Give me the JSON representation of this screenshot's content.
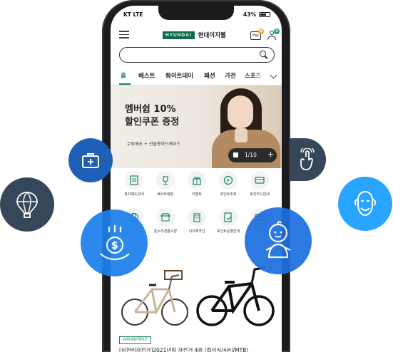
{
  "status_bar": {
    "carrier": "KT  LTE",
    "battery": "43%"
  },
  "header": {
    "logo_mark": "HYUNDAI",
    "logo_text": "현대이지웰",
    "npay_label": "Pay",
    "npay_badge": "N",
    "user_badge": "2"
  },
  "search": {
    "placeholder": ""
  },
  "tabs": [
    {
      "label": "홈",
      "active": true
    },
    {
      "label": "베스트"
    },
    {
      "label": "화이트데이"
    },
    {
      "label": "패션"
    },
    {
      "label": "가전"
    },
    {
      "label": "스포츠"
    }
  ],
  "banner": {
    "title_line1": "멤버쉽 10%",
    "title_line2": "할인쿠폰 증정",
    "subtitle": "무료배송 + 선물용하드케이스",
    "page_indicator": "1/10",
    "plus": "+"
  },
  "quick_menu": [
    {
      "label": "복지제도안내",
      "icon": "document-icon"
    },
    {
      "label": "베스트랭킹",
      "icon": "trophy-icon"
    },
    {
      "label": "이벤트",
      "icon": "gift-icon"
    },
    {
      "label": "포인트조회",
      "icon": "point-icon"
    },
    {
      "label": "복지카드안내",
      "icon": "card-icon"
    },
    {
      "label": "",
      "icon": "globe-icon"
    },
    {
      "label": "온누리전통시장",
      "icon": "market-icon"
    },
    {
      "label": "이지체크인",
      "icon": "building-icon"
    },
    {
      "label": "포인트운영안내",
      "icon": "doc-check-icon"
    },
    {
      "label": "",
      "icon": "card-icon"
    }
  ],
  "product": {
    "badge": "슈퍼세븐데이즈",
    "title": "[삼천리자전거]2021년형 자전거 4종 (접이식/씨티/MTB)"
  },
  "floating_icons": [
    {
      "name": "medical-kit-icon",
      "color": "#1e60b8"
    },
    {
      "name": "hot-air-balloon-icon",
      "color": "#37475a"
    },
    {
      "name": "money-hand-icon",
      "color": "#1d7fec"
    },
    {
      "name": "touch-hand-icon",
      "color": "#37475a"
    },
    {
      "name": "baby-icon",
      "color": "#1d6fe0"
    },
    {
      "name": "elderly-face-icon",
      "color": "#2aa5ff"
    }
  ],
  "colors": {
    "brand_green": "#16856a",
    "logo_green": "#0d6b4b"
  }
}
